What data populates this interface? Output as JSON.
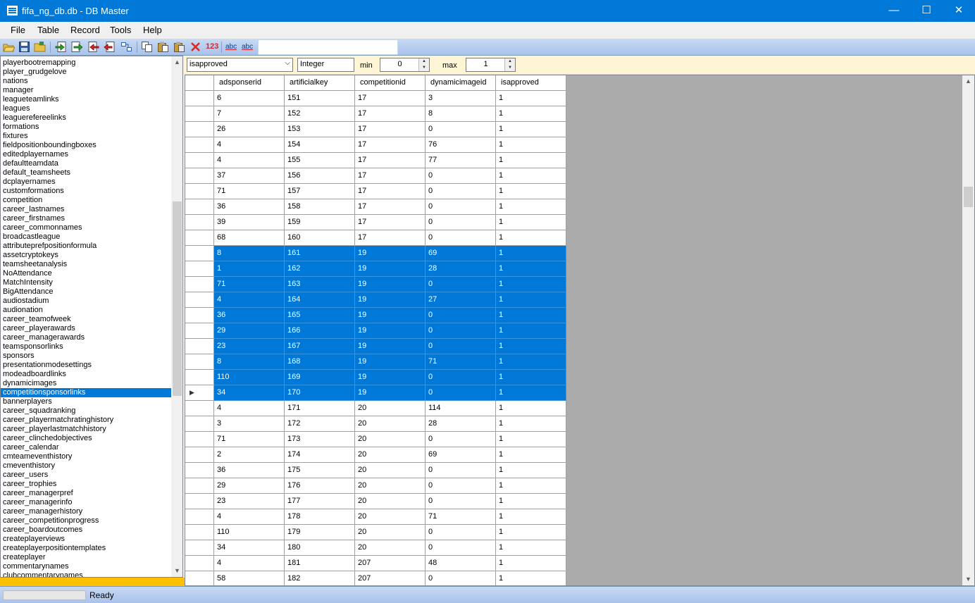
{
  "window": {
    "title": "fifa_ng_db.db - DB Master",
    "minimize": "—",
    "maximize": "☐",
    "close": "✕"
  },
  "menu": [
    "File",
    "Table",
    "Record",
    "Tools",
    "Help"
  ],
  "toolbar": {
    "icons": [
      "open-icon",
      "save-icon",
      "open-folder-icon",
      "import-icon",
      "export-icon",
      "delete-record-icon",
      "remove-record-icon",
      "link-icon",
      "copy-icon",
      "paste-icon",
      "paste-special-icon",
      "clear-icon",
      "number-icon",
      "spellcheck-icon",
      "spellcheck-alt-icon"
    ],
    "number_label": "123",
    "abc_label": "abc",
    "search_value": ""
  },
  "tables": [
    "playerbootremapping",
    "player_grudgelove",
    "nations",
    "manager",
    "leagueteamlinks",
    "leagues",
    "leaguerefereelinks",
    "formations",
    "fixtures",
    "fieldpositionboundingboxes",
    "editedplayernames",
    "defaultteamdata",
    "default_teamsheets",
    "dcplayernames",
    "customformations",
    "competition",
    "career_lastnames",
    "career_firstnames",
    "career_commonnames",
    "broadcastleague",
    "attributeprefpositionformula",
    "assetcryptokeys",
    "teamsheetanalysis",
    "NoAttendance",
    "MatchIntensity",
    "BigAttendance",
    "audiostadium",
    "audionation",
    "career_teamofweek",
    "career_playerawards",
    "career_managerawards",
    "teamsponsorlinks",
    "sponsors",
    "presentationmodesettings",
    "modeadboardlinks",
    "dynamicimages",
    "competitionsponsorlinks",
    "bannerplayers",
    "career_squadranking",
    "career_playermatchratinghistory",
    "career_playerlastmatchhistory",
    "career_clinchedobjectives",
    "career_calendar",
    "cmteameventhistory",
    "cmeventhistory",
    "career_users",
    "career_trophies",
    "career_managerpref",
    "career_managerinfo",
    "career_managerhistory",
    "career_competitionprogress",
    "career_boardoutcomes",
    "createplayerviews",
    "createplayerpositiontemplates",
    "createplayer",
    "commentarynames",
    "clubcommentarynames"
  ],
  "selected_table": "competitionsponsorlinks",
  "filter": {
    "column": "isapproved",
    "type": "Integer",
    "min_label": "min",
    "min_value": "0",
    "max_label": "max",
    "max_value": "1"
  },
  "grid": {
    "columns": [
      "adsponserid",
      "artificialkey",
      "competitionid",
      "dynamicimageid",
      "isapproved"
    ],
    "current_row_marker": "▶",
    "rows": [
      {
        "adsponserid": "6",
        "artificialkey": "151",
        "competitionid": "17",
        "dynamicimageid": "3",
        "isapproved": "1",
        "selected": false
      },
      {
        "adsponserid": "7",
        "artificialkey": "152",
        "competitionid": "17",
        "dynamicimageid": "8",
        "isapproved": "1",
        "selected": false
      },
      {
        "adsponserid": "26",
        "artificialkey": "153",
        "competitionid": "17",
        "dynamicimageid": "0",
        "isapproved": "1",
        "selected": false
      },
      {
        "adsponserid": "4",
        "artificialkey": "154",
        "competitionid": "17",
        "dynamicimageid": "76",
        "isapproved": "1",
        "selected": false
      },
      {
        "adsponserid": "4",
        "artificialkey": "155",
        "competitionid": "17",
        "dynamicimageid": "77",
        "isapproved": "1",
        "selected": false
      },
      {
        "adsponserid": "37",
        "artificialkey": "156",
        "competitionid": "17",
        "dynamicimageid": "0",
        "isapproved": "1",
        "selected": false
      },
      {
        "adsponserid": "71",
        "artificialkey": "157",
        "competitionid": "17",
        "dynamicimageid": "0",
        "isapproved": "1",
        "selected": false
      },
      {
        "adsponserid": "36",
        "artificialkey": "158",
        "competitionid": "17",
        "dynamicimageid": "0",
        "isapproved": "1",
        "selected": false
      },
      {
        "adsponserid": "39",
        "artificialkey": "159",
        "competitionid": "17",
        "dynamicimageid": "0",
        "isapproved": "1",
        "selected": false
      },
      {
        "adsponserid": "68",
        "artificialkey": "160",
        "competitionid": "17",
        "dynamicimageid": "0",
        "isapproved": "1",
        "selected": false
      },
      {
        "adsponserid": "8",
        "artificialkey": "161",
        "competitionid": "19",
        "dynamicimageid": "69",
        "isapproved": "1",
        "selected": true
      },
      {
        "adsponserid": "1",
        "artificialkey": "162",
        "competitionid": "19",
        "dynamicimageid": "28",
        "isapproved": "1",
        "selected": true
      },
      {
        "adsponserid": "71",
        "artificialkey": "163",
        "competitionid": "19",
        "dynamicimageid": "0",
        "isapproved": "1",
        "selected": true
      },
      {
        "adsponserid": "4",
        "artificialkey": "164",
        "competitionid": "19",
        "dynamicimageid": "27",
        "isapproved": "1",
        "selected": true
      },
      {
        "adsponserid": "36",
        "artificialkey": "165",
        "competitionid": "19",
        "dynamicimageid": "0",
        "isapproved": "1",
        "selected": true
      },
      {
        "adsponserid": "29",
        "artificialkey": "166",
        "competitionid": "19",
        "dynamicimageid": "0",
        "isapproved": "1",
        "selected": true
      },
      {
        "adsponserid": "23",
        "artificialkey": "167",
        "competitionid": "19",
        "dynamicimageid": "0",
        "isapproved": "1",
        "selected": true
      },
      {
        "adsponserid": "8",
        "artificialkey": "168",
        "competitionid": "19",
        "dynamicimageid": "71",
        "isapproved": "1",
        "selected": true
      },
      {
        "adsponserid": "110",
        "artificialkey": "169",
        "competitionid": "19",
        "dynamicimageid": "0",
        "isapproved": "1",
        "selected": true
      },
      {
        "adsponserid": "34",
        "artificialkey": "170",
        "competitionid": "19",
        "dynamicimageid": "0",
        "isapproved": "1",
        "selected": true,
        "current": true
      },
      {
        "adsponserid": "4",
        "artificialkey": "171",
        "competitionid": "20",
        "dynamicimageid": "114",
        "isapproved": "1",
        "selected": false
      },
      {
        "adsponserid": "3",
        "artificialkey": "172",
        "competitionid": "20",
        "dynamicimageid": "28",
        "isapproved": "1",
        "selected": false
      },
      {
        "adsponserid": "71",
        "artificialkey": "173",
        "competitionid": "20",
        "dynamicimageid": "0",
        "isapproved": "1",
        "selected": false
      },
      {
        "adsponserid": "2",
        "artificialkey": "174",
        "competitionid": "20",
        "dynamicimageid": "69",
        "isapproved": "1",
        "selected": false
      },
      {
        "adsponserid": "36",
        "artificialkey": "175",
        "competitionid": "20",
        "dynamicimageid": "0",
        "isapproved": "1",
        "selected": false
      },
      {
        "adsponserid": "29",
        "artificialkey": "176",
        "competitionid": "20",
        "dynamicimageid": "0",
        "isapproved": "1",
        "selected": false
      },
      {
        "adsponserid": "23",
        "artificialkey": "177",
        "competitionid": "20",
        "dynamicimageid": "0",
        "isapproved": "1",
        "selected": false
      },
      {
        "adsponserid": "4",
        "artificialkey": "178",
        "competitionid": "20",
        "dynamicimageid": "71",
        "isapproved": "1",
        "selected": false
      },
      {
        "adsponserid": "110",
        "artificialkey": "179",
        "competitionid": "20",
        "dynamicimageid": "0",
        "isapproved": "1",
        "selected": false
      },
      {
        "adsponserid": "34",
        "artificialkey": "180",
        "competitionid": "20",
        "dynamicimageid": "0",
        "isapproved": "1",
        "selected": false
      },
      {
        "adsponserid": "4",
        "artificialkey": "181",
        "competitionid": "207",
        "dynamicimageid": "48",
        "isapproved": "1",
        "selected": false
      },
      {
        "adsponserid": "58",
        "artificialkey": "182",
        "competitionid": "207",
        "dynamicimageid": "0",
        "isapproved": "1",
        "selected": false
      }
    ]
  },
  "status": {
    "text": "Ready"
  },
  "colors": {
    "title_bar": "#0078d7",
    "selection": "#0078d7",
    "filter_bar": "#fdf5d5",
    "grid_background": "#ababab",
    "sidebar_bottom": "#ffc000"
  }
}
